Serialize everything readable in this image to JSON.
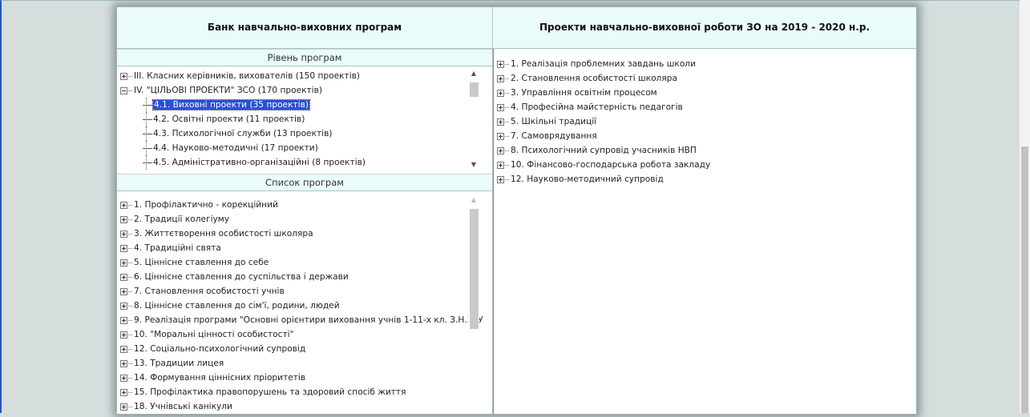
{
  "left_title": "Банк навчально-виховних програм",
  "right_title": "Проекти навчально-виховної роботи ЗО на 2019 - 2020 н.р.",
  "levels": {
    "header": "Рівень програм",
    "items": [
      "III. Класних керівників, вихователів (150 проектів)",
      "IV. \"ЦІЛЬОВІ ПРОЕКТИ\" ЗСО (170 проектів)",
      "4.1. Виховні проекти (35 проектів)",
      "4.2. Освітні проекти (11 проектів)",
      "4.3. Психологічної служби (13 проектів)",
      "4.4. Науково-методичні (17 проекти)",
      "4.5. Адміністративно-організаційні (8 проектів)"
    ]
  },
  "programs": {
    "header": "Список програм",
    "items": [
      "1. Профілактично - корекційний",
      "2. Традиції колегіуму",
      "3.  Життєтворення особистості школяра",
      "4. Традиційні свята",
      "5.  Ціннісне ставлення до себе",
      "6. Ціннісне ставлення до суспільства і держави",
      "7. Становлення особистості учнів",
      "8. Ціннісне ставлення до сім'ї, родини, людей",
      "9.  Реалізація програми \"Основні орієнтири виховання учнів 1-11-х кл. З.Н.З. У",
      "10. \"Моральні цінності особистості\"",
      "12. Соціально-психологічний супровід",
      "13. Традиции лицея",
      "14. Формування ціннісних пріоритетів",
      "15. Профілактика правопорушень та здоровий спосіб життя",
      "18. Учнівські канікули"
    ]
  },
  "projects": {
    "items": [
      "1. Реалізація проблемних завдань школи",
      "2. Становлення особистості школяра",
      "3. Управління освітнім процесом",
      "4. Професійна майстерність педагогів",
      "5. Шкільні традиції",
      "7. Самоврядування",
      "8. Психологічний супровід учасників НВП",
      "10. Фінансово-господарська робота закладу",
      "12. Науково-методичний супровід"
    ]
  }
}
